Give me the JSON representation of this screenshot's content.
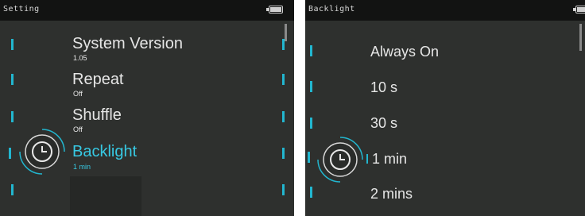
{
  "left_screen": {
    "title": "Setting",
    "items": [
      {
        "label": "System Version",
        "value": "1.05"
      },
      {
        "label": "Repeat",
        "value": "Off"
      },
      {
        "label": "Shuffle",
        "value": "Off"
      },
      {
        "label": "Backlight",
        "value": "1 min"
      }
    ],
    "selected_index": 3,
    "icon": "clock-icon"
  },
  "right_screen": {
    "title": "Backlight",
    "options": [
      "Always On",
      "10 s",
      "30 s",
      "1 min",
      "2 mins"
    ],
    "selected_index": 3,
    "icon": "clock-icon"
  },
  "colors": {
    "accent": "#37c9e3",
    "screen_bg": "#2e302e",
    "title_bar": "#121312",
    "text": "#e6e6e6"
  }
}
